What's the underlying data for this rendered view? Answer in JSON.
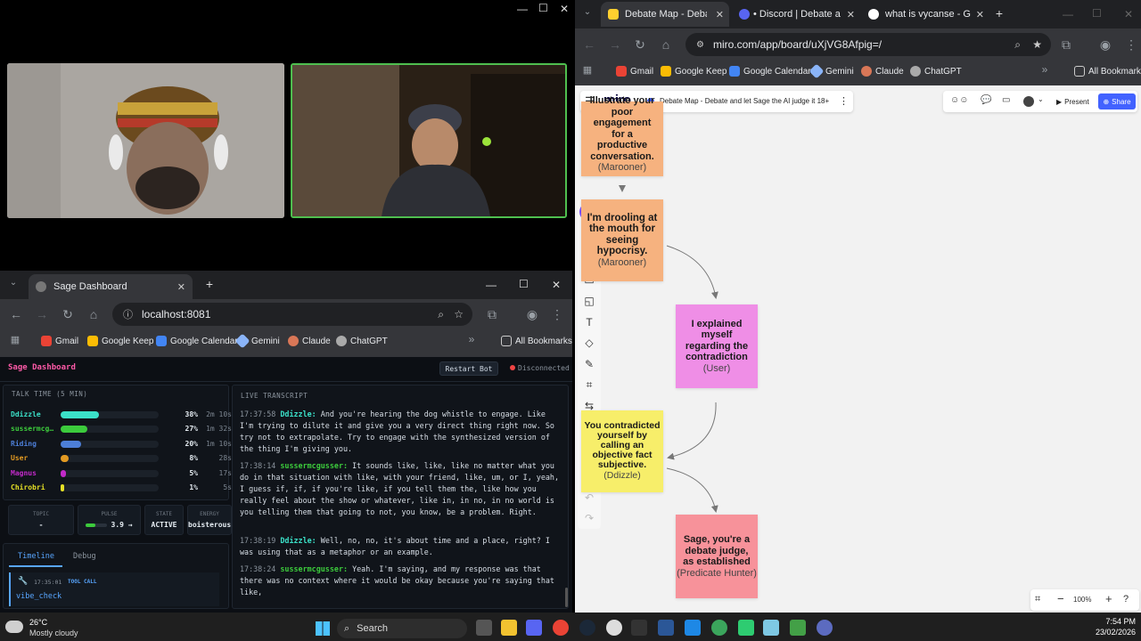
{
  "left_window": {
    "controls": {
      "minimize": "—",
      "maximize": "☐",
      "close": "✕"
    }
  },
  "sage_browser": {
    "tab_title": "Sage Dashboard",
    "new_tab": "+",
    "url": "localhost:8081",
    "win_min": "—",
    "win_max": "☐",
    "win_close": "✕",
    "bookmarks": [
      "Gmail",
      "Google Keep",
      "Google Calendar",
      "Gemini",
      "Claude",
      "ChatGPT"
    ],
    "all_bookmarks": "All Bookmarks"
  },
  "sage": {
    "title": "Sage Dashboard",
    "restart_label": "Restart Bot",
    "status": "Disconnected",
    "talk_time_title": "TALK TIME (5 MIN)",
    "talk_time": [
      {
        "name": "Ddizzle",
        "pct": "38%",
        "time": "2m 10s",
        "frac": 0.38,
        "color": "#3be0c8"
      },
      {
        "name": "sussermcg…",
        "pct": "27%",
        "time": "1m 32s",
        "frac": 0.27,
        "color": "#3ccb3c"
      },
      {
        "name": "Riding",
        "pct": "20%",
        "time": "1m 10s",
        "frac": 0.2,
        "color": "#4d7fd8"
      },
      {
        "name": "User",
        "pct": "8%",
        "time": "28s",
        "frac": 0.08,
        "color": "#e39a22"
      },
      {
        "name": "Magnus",
        "pct": "5%",
        "time": "17s",
        "frac": 0.05,
        "color": "#c22ac9"
      },
      {
        "name": "Chirobri",
        "pct": "1%",
        "time": "5s",
        "frac": 0.01,
        "color": "#e5e026"
      }
    ],
    "stats": {
      "topic_label": "TOPIC",
      "topic_value": "-",
      "pulse_label": "PULSE",
      "pulse_value": "3.9 →",
      "pulse_frac": 0.45,
      "state_label": "STATE",
      "state_value": "ACTIVE",
      "energy_label": "ENERGY",
      "energy_value": "boisterous"
    },
    "tabs": [
      "Timeline",
      "Debug"
    ],
    "timeline_time": "17:35:01",
    "timeline_tag": "TOOL CALL",
    "timeline_value": "vibe_check",
    "transcript_title": "LIVE TRANSCRIPT",
    "transcript": [
      {
        "time": "17:37:58",
        "speaker": "Ddizzle:",
        "color": "#3be0c8",
        "text": "And you're hearing the dog whistle to engage. Like I'm trying to dilute it and give you a very direct thing right now. So try not to extrapolate. Try to engage with the synthesized version of the thing I'm giving you."
      },
      {
        "time": "17:38:14",
        "speaker": "sussermcgusser:",
        "color": "#3ccb3c",
        "text": "It sounds like, like, like no matter what you do in that situation with like, with your friend, like, um, or I, yeah, I guess if, if, if you're like, if you tell them the, like how you really feel about the show or whatever, like in, in no, in no world is you telling them that going to not, you know, be a problem. Right."
      },
      {
        "time": "17:38:19",
        "speaker": "Ddizzle:",
        "color": "#3be0c8",
        "text": "Well, no, no, it's about time and a place, right? I was using that as a metaphor or an example."
      },
      {
        "time": "17:38:24",
        "speaker": "sussermcgusser:",
        "color": "#3ccb3c",
        "text": "Yeah. I'm saying, and my response was that there was no context where it would be okay because you're saying that like,"
      }
    ]
  },
  "miro_browser": {
    "tabs": [
      "Debate Map - Debate an",
      "• Discord | Debate and l",
      "what is vycanse - Googl"
    ],
    "new_tab": "+",
    "url": "miro.com/app/board/uXjVG8Afpig=/",
    "bookmarks": [
      "Gmail",
      "Google Keep",
      "Google Calendar",
      "Gemini",
      "Claude",
      "ChatGPT"
    ],
    "all_bookmarks": "All Bookmarks"
  },
  "miro": {
    "logo": "miro",
    "board_title": "Debate Map - Debate and let Sage the AI judge it 18+",
    "present_label": "Present",
    "share_label": "Share",
    "zoom": "100%",
    "notes": [
      {
        "text": "illustrate your poor engagement for a productive conversation.",
        "author": "(Marooner)",
        "color": "#f6b27f"
      },
      {
        "text": "I'm drooling at the mouth for seeing hypocrisy.",
        "author": "(Marooner)",
        "color": "#f6b27f"
      },
      {
        "text": "I explained myself regarding the contradiction",
        "author": "(User)",
        "color": "#ef8ee6"
      },
      {
        "text": "You contradicted yourself by calling an objective fact subjective.",
        "author": "(Ddizzle)",
        "color": "#f7ee6a"
      },
      {
        "text": "Sage, you're a debate judge, as established",
        "author": "(Predicate Hunter)",
        "color": "#f7929a"
      }
    ]
  },
  "taskbar": {
    "weather_temp": "26°C",
    "weather_desc": "Mostly cloudy",
    "search": "Search",
    "time": "7:54 PM",
    "date": "23/02/2026"
  }
}
